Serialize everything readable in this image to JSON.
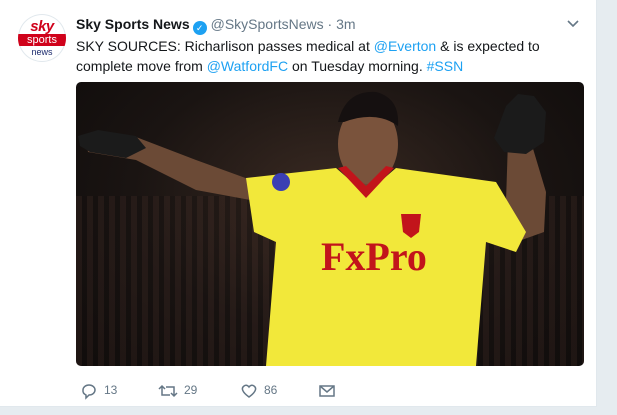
{
  "tweet": {
    "author": {
      "name": "Sky Sports News",
      "handle": "@SkySportsNews",
      "separator": "·",
      "time": "3m",
      "avatar_logo": {
        "top": "sky",
        "band": "sports",
        "sub": "news"
      }
    },
    "text": {
      "part1": "SKY SOURCES: Richarlison passes medical at ",
      "mention1": "@Everton",
      "part2": " & is expected to complete move from ",
      "mention2": "@WatfordFC",
      "part3": " on Tuesday morning. ",
      "hashtag": "#SSN"
    },
    "image": {
      "subject": "Footballer in yellow Watford kit with FxPro sponsor celebrating with arms outstretched",
      "shirt_sponsor": "FxPro"
    },
    "actions": {
      "replies": "13",
      "retweets": "29",
      "likes": "86"
    },
    "icons": {
      "verified": "verified-badge-icon",
      "caret": "chevron-down-icon",
      "reply": "reply-icon",
      "retweet": "retweet-icon",
      "like": "heart-icon",
      "dm": "envelope-icon"
    },
    "colors": {
      "link": "#1da1f2",
      "secondary_text": "#657786",
      "sky_red": "#d0021b",
      "kit_yellow": "#f2e83a"
    }
  }
}
